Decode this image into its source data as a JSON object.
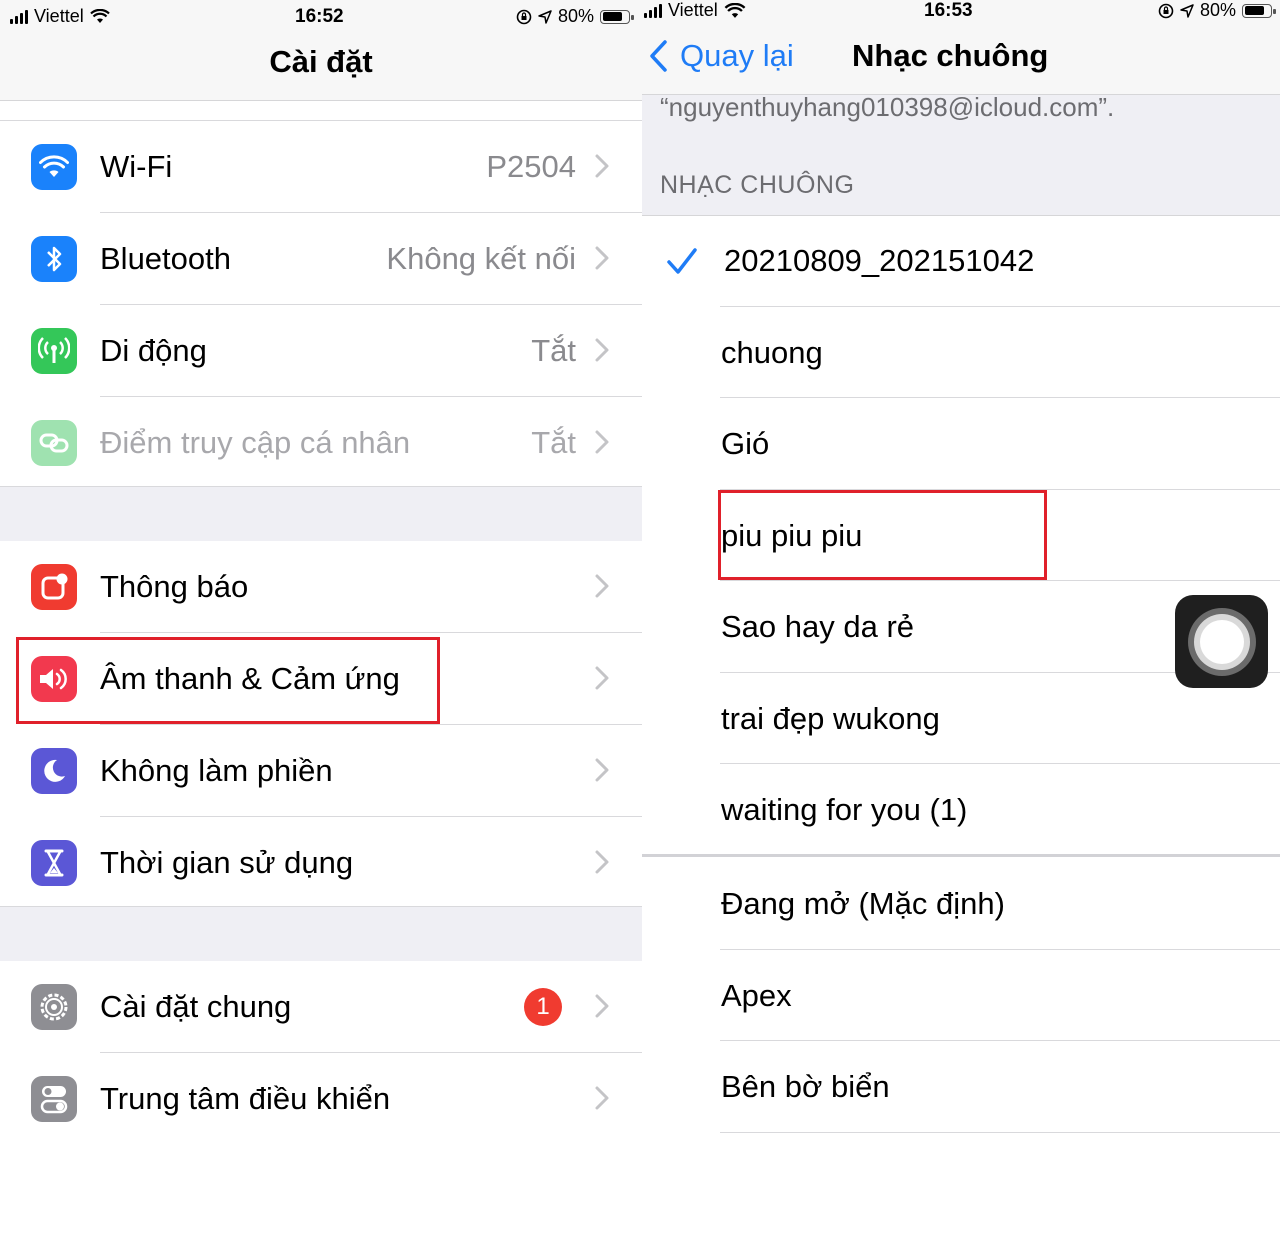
{
  "left": {
    "status": {
      "carrier": "Viettel",
      "time": "16:52",
      "battery": "80%",
      "battery_level": 0.8
    },
    "title": "Cài đặt",
    "group1": [
      {
        "label": "Wi-Fi",
        "value": "P2504",
        "icon": "wifi-icon",
        "color": "#1a82fb"
      },
      {
        "label": "Bluetooth",
        "value": "Không kết nối",
        "icon": "bluetooth-icon",
        "color": "#1a82fb"
      },
      {
        "label": "Di động",
        "value": "Tắt",
        "icon": "antenna-icon",
        "color": "#34c759"
      },
      {
        "label": "Điểm truy cập cá nhân",
        "value": "Tắt",
        "icon": "link-icon",
        "color": "#9fe2b0"
      }
    ],
    "group2": [
      {
        "label": "Thông báo",
        "icon": "notification-icon",
        "color": "#f03b30"
      },
      {
        "label": "Âm thanh & Cảm ứng",
        "icon": "speaker-icon",
        "color": "#f2394e"
      },
      {
        "label": "Không làm phiền",
        "icon": "moon-icon",
        "color": "#5b57d6"
      },
      {
        "label": "Thời gian sử dụng",
        "icon": "hourglass-icon",
        "color": "#5b57d6"
      }
    ],
    "group3": [
      {
        "label": "Cài đặt chung",
        "badge": "1",
        "icon": "gear-icon",
        "color": "#8e8e93"
      },
      {
        "label": "Trung tâm điều khiển",
        "icon": "toggles-icon",
        "color": "#8e8e93"
      }
    ]
  },
  "right": {
    "status": {
      "carrier": "Viettel",
      "time": "16:53",
      "battery": "80%",
      "battery_level": 0.8
    },
    "back_label": "Quay lại",
    "title": "Nhạc chuông",
    "icloud_text": "“nguyenthuyhang010398@icloud.com”.",
    "section_header": "NHẠC CHUÔNG",
    "custom_tones": [
      {
        "label": "20210809_202151042",
        "selected": true
      },
      {
        "label": "chuong"
      },
      {
        "label": "Gió"
      },
      {
        "label": "piu piu piu"
      },
      {
        "label": "Sao hay da rẻ"
      },
      {
        "label": "trai đẹp wukong"
      },
      {
        "label": "waiting for you (1)"
      }
    ],
    "system_tones": [
      {
        "label": "Đang mở (Mặc định)"
      },
      {
        "label": "Apex"
      },
      {
        "label": "Bên bờ biển"
      }
    ]
  },
  "colors": {
    "accent": "#1f7cf6",
    "highlight": "#e0202a",
    "group_bg": "#efeff4"
  }
}
